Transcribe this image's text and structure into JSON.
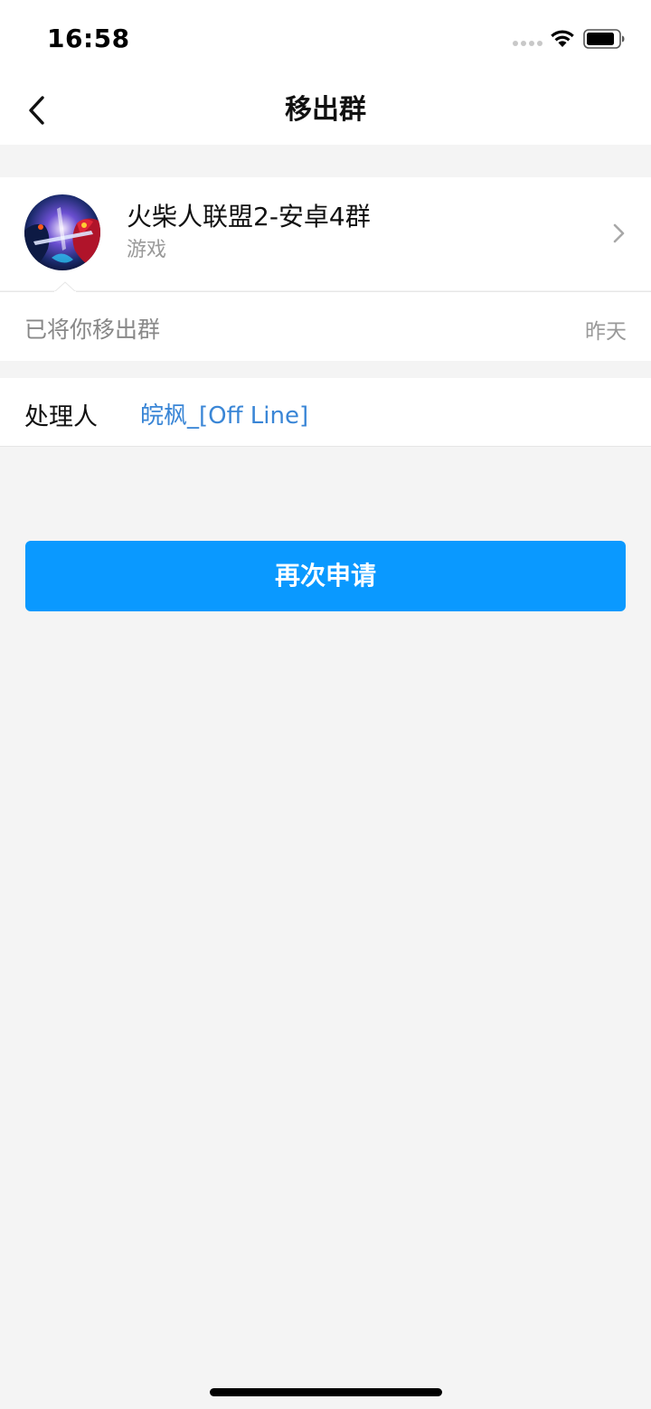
{
  "status_bar": {
    "time": "16:58"
  },
  "nav": {
    "title": "移出群"
  },
  "group": {
    "name": "火柴人联盟2-安卓4群",
    "category": "游戏"
  },
  "notice": {
    "text": "已将你移出群",
    "time": "昨天"
  },
  "handler": {
    "label": "处理人",
    "name": "皖枫_[Off Line]"
  },
  "actions": {
    "reapply_label": "再次申请"
  },
  "colors": {
    "accent_blue": "#0a99ff",
    "link_blue": "#3a86d6",
    "background": "#f4f4f4"
  }
}
